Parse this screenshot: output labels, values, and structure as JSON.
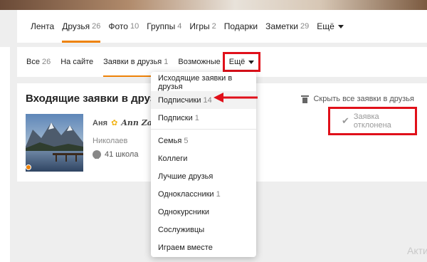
{
  "profile_nav": {
    "items": [
      {
        "label": "Лента",
        "count": ""
      },
      {
        "label": "Друзья",
        "count": "26"
      },
      {
        "label": "Фото",
        "count": "10"
      },
      {
        "label": "Группы",
        "count": "4"
      },
      {
        "label": "Игры",
        "count": "2"
      },
      {
        "label": "Подарки",
        "count": ""
      },
      {
        "label": "Заметки",
        "count": "29"
      },
      {
        "label": "Ещё",
        "count": ""
      }
    ],
    "active_index": 1
  },
  "sub_nav": {
    "items": [
      {
        "label": "Все",
        "count": "26"
      },
      {
        "label": "На сайте",
        "count": ""
      },
      {
        "label": "Заявки в друзья",
        "count": "1"
      },
      {
        "label": "Возможные друзья",
        "count": ""
      }
    ],
    "active_index": 2,
    "more_label": "Ещё"
  },
  "content": {
    "title": "Входящие заявки в друзья",
    "hide_all_label": "Скрыть все заявки в друзья"
  },
  "request": {
    "first_name": "Аня",
    "crown_glyph": "✿",
    "script_name": "Ann Zaj",
    "surname": "Николаев",
    "school": "41 школа",
    "status": "Заявка отклонена",
    "check_glyph": "✔"
  },
  "dropdown": {
    "items": [
      {
        "label": "Исходящие заявки в друзья",
        "count": ""
      },
      {
        "label": "Подписчики",
        "count": "14"
      },
      {
        "label": "Подписки",
        "count": "1"
      },
      {
        "label": "Семья",
        "count": "5"
      },
      {
        "label": "Коллеги",
        "count": ""
      },
      {
        "label": "Лучшие друзья",
        "count": ""
      },
      {
        "label": "Одноклассники",
        "count": "1"
      },
      {
        "label": "Однокурсники",
        "count": ""
      },
      {
        "label": "Сослуживцы",
        "count": ""
      },
      {
        "label": "Играем вместе",
        "count": ""
      }
    ],
    "highlight_index": 1
  },
  "watermark": "Акти",
  "colors": {
    "accent": "#ee8208",
    "annotation_red": "#e0101a"
  }
}
